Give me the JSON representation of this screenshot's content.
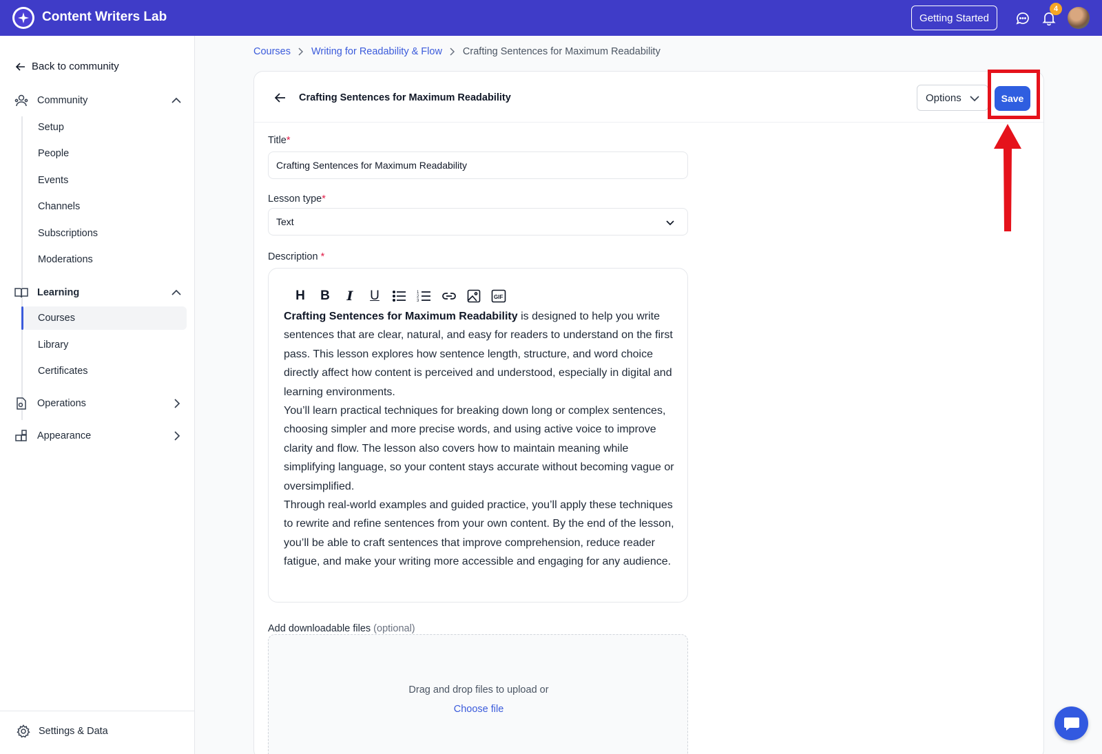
{
  "app": {
    "title": "Content Writers Lab",
    "getting_started_label": "Getting Started",
    "notification_count": "4",
    "colors": {
      "topbar": "#3f3cc8",
      "accent": "#2f5ee0",
      "highlight": "#e5121b"
    }
  },
  "sidebar": {
    "back_label": "Back to community",
    "community": {
      "label": "Community",
      "items": [
        {
          "label": "Setup"
        },
        {
          "label": "People"
        },
        {
          "label": "Events"
        },
        {
          "label": "Channels"
        },
        {
          "label": "Subscriptions"
        },
        {
          "label": "Moderations"
        }
      ]
    },
    "learning": {
      "label": "Learning",
      "items": [
        {
          "label": "Courses",
          "active": true
        },
        {
          "label": "Library"
        },
        {
          "label": "Certificates"
        }
      ]
    },
    "operations_label": "Operations",
    "appearance_label": "Appearance",
    "settings_label": "Settings & Data"
  },
  "breadcrumb": [
    {
      "label": "Courses"
    },
    {
      "label": "Writing for Readability & Flow"
    },
    {
      "label": "Crafting Sentences for Maximum Readability"
    }
  ],
  "lesson": {
    "header_title": "Crafting Sentences for Maximum Readability",
    "options_label": "Options",
    "save_label": "Save",
    "title_label": "Title",
    "title_value": "Crafting Sentences for Maximum Readability",
    "type_label": "Lesson type",
    "type_value": "Text",
    "description_label": "Description",
    "description": {
      "lead_bold": "Crafting Sentences for Maximum Readability",
      "lead_rest": " is designed to help you write sentences that are clear, natural, and easy for readers to understand on the first pass. This lesson explores how sentence length, structure, and word choice directly affect how content is perceived and understood, especially in digital and learning environments.",
      "para2": "You’ll learn practical techniques for breaking down long or complex sentences, choosing simpler and more precise words, and using active voice to improve clarity and flow. The lesson also covers how to maintain meaning while simplifying language, so your content stays accurate without becoming vague or oversimplified.",
      "para3": "Through real-world examples and guided practice, you’ll apply these techniques to rewrite and refine sentences from your own content. By the end of the lesson, you’ll be able to craft sentences that improve comprehension, reduce reader fatigue, and make your writing more accessible and engaging for any audience."
    },
    "files_label": "Add downloadable files",
    "files_optional": "(optional)",
    "drop_text": "Drag and drop files to upload or",
    "choose_file": "Choose file"
  },
  "icons": {
    "toolbar": [
      "heading-icon",
      "bold-icon",
      "italic-icon",
      "underline-icon",
      "bullet-list-icon",
      "numbered-list-icon",
      "link-icon",
      "image-icon",
      "gif-icon"
    ]
  }
}
